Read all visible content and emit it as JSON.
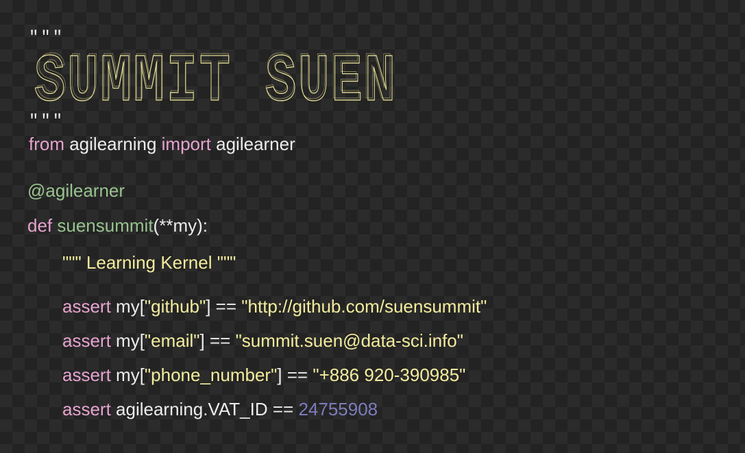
{
  "docstring": {
    "open_quotes": "\"\"\"",
    "close_quotes": "\"\"\"",
    "banner_text": "SUMMIT SUEN"
  },
  "import_line": {
    "kw_from": "from",
    "module": " agilearning ",
    "kw_import": "import",
    "name": " agilearner"
  },
  "decorator": {
    "text": "@agilearner"
  },
  "def_line": {
    "kw_def": "def",
    "func_name": " suensummit",
    "params": "(**my):"
  },
  "func_docstring": {
    "text": "\"\"\" Learning Kernel \"\"\""
  },
  "asserts": [
    {
      "kw": "assert",
      "lhs_prefix": " my[",
      "key": "\"github\"",
      "op": "] == ",
      "value": "\"http://github.com/suensummit\""
    },
    {
      "kw": "assert",
      "lhs_prefix": " my[",
      "key": "\"email\"",
      "op": "] == ",
      "value": "\"summit.suen@data-sci.info\""
    },
    {
      "kw": "assert",
      "lhs_prefix": " my[",
      "key": "\"phone_number\"",
      "op": "] == ",
      "value": "\"+886 920-390985\""
    },
    {
      "kw": "assert",
      "lhs": " agilearning.VAT_ID == ",
      "number": "24755908"
    }
  ],
  "colors": {
    "keyword": "#e6a3cf",
    "function": "#98c38f",
    "string": "#f3ec9d",
    "plain": "#ececec",
    "number": "#7d7cbd",
    "background_light": "#2b2b2b",
    "background_dark": "#232323"
  }
}
